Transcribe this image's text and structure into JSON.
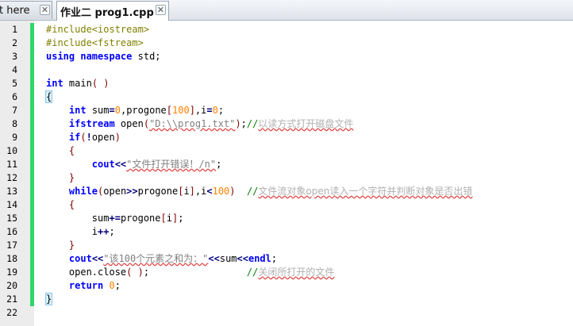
{
  "tabs": [
    {
      "label": "t here",
      "close": "✕",
      "active": false
    },
    {
      "label": "作业二 prog1.cpp",
      "close": "✕",
      "active": true
    }
  ],
  "editor": {
    "lines": [
      {
        "n": "1",
        "tokens": [
          {
            "t": "#include<iostream>",
            "c": "pp"
          }
        ]
      },
      {
        "n": "2",
        "tokens": [
          {
            "t": "#include<fstream>",
            "c": "pp"
          }
        ]
      },
      {
        "n": "3",
        "tokens": [
          {
            "t": "using",
            "c": "kw"
          },
          {
            "t": " "
          },
          {
            "t": "namespace",
            "c": "kw"
          },
          {
            "t": " std;"
          }
        ]
      },
      {
        "n": "4",
        "tokens": []
      },
      {
        "n": "5",
        "tokens": [
          {
            "t": "int",
            "c": "kw"
          },
          {
            "t": " main"
          },
          {
            "t": "( )",
            "c": "br"
          }
        ]
      },
      {
        "n": "6",
        "tokens": [
          {
            "t": "{",
            "c": "brace-hl"
          }
        ]
      },
      {
        "n": "7",
        "tokens": [
          {
            "t": "    "
          },
          {
            "t": "int",
            "c": "kw"
          },
          {
            "t": " sum"
          },
          {
            "t": "=",
            "c": "op"
          },
          {
            "t": "0",
            "c": "num"
          },
          {
            "t": ",progone"
          },
          {
            "t": "[",
            "c": "br"
          },
          {
            "t": "100",
            "c": "num"
          },
          {
            "t": "]",
            "c": "br"
          },
          {
            "t": ",i"
          },
          {
            "t": "=",
            "c": "op"
          },
          {
            "t": "0",
            "c": "num"
          },
          {
            "t": ";"
          }
        ]
      },
      {
        "n": "8",
        "tokens": [
          {
            "t": "    "
          },
          {
            "t": "ifstream",
            "c": "kw"
          },
          {
            "t": " open"
          },
          {
            "t": "(",
            "c": "br"
          },
          {
            "t": "\"D:\\\\prog1.txt\"",
            "c": "str sq"
          },
          {
            "t": ")",
            "c": "br"
          },
          {
            "t": ";"
          },
          {
            "t": "//",
            "c": "cm"
          },
          {
            "t": "以读方式打开磁盘文件",
            "c": "cmt"
          }
        ]
      },
      {
        "n": "9",
        "tokens": [
          {
            "t": "    "
          },
          {
            "t": "if",
            "c": "kw"
          },
          {
            "t": "(",
            "c": "br"
          },
          {
            "t": "!",
            "c": "op"
          },
          {
            "t": "open"
          },
          {
            "t": ")",
            "c": "br"
          }
        ]
      },
      {
        "n": "10",
        "tokens": [
          {
            "t": "    "
          },
          {
            "t": "{",
            "c": "br"
          }
        ]
      },
      {
        "n": "11",
        "tokens": [
          {
            "t": "        "
          },
          {
            "t": "cout",
            "c": "kw"
          },
          {
            "t": "<<",
            "c": "op"
          },
          {
            "t": "\"文件打开错误！/n\"",
            "c": "str sq"
          },
          {
            "t": ";"
          }
        ]
      },
      {
        "n": "12",
        "tokens": [
          {
            "t": "    "
          },
          {
            "t": "}",
            "c": "br"
          }
        ]
      },
      {
        "n": "13",
        "tokens": [
          {
            "t": "    "
          },
          {
            "t": "while",
            "c": "kw"
          },
          {
            "t": "(",
            "c": "br"
          },
          {
            "t": "open"
          },
          {
            "t": ">>",
            "c": "op"
          },
          {
            "t": "progone"
          },
          {
            "t": "[",
            "c": "br"
          },
          {
            "t": "i"
          },
          {
            "t": "]",
            "c": "br"
          },
          {
            "t": ",i"
          },
          {
            "t": "<",
            "c": "op"
          },
          {
            "t": "100",
            "c": "num"
          },
          {
            "t": ")",
            "c": "br"
          },
          {
            "t": "  "
          },
          {
            "t": "//",
            "c": "cm"
          },
          {
            "t": "文件流对象open读入一个字符并判断对象是否出错",
            "c": "cmt"
          }
        ]
      },
      {
        "n": "14",
        "tokens": [
          {
            "t": "    "
          },
          {
            "t": "{",
            "c": "br"
          }
        ]
      },
      {
        "n": "15",
        "tokens": [
          {
            "t": "        sum"
          },
          {
            "t": "+=",
            "c": "op"
          },
          {
            "t": "progone"
          },
          {
            "t": "[",
            "c": "br"
          },
          {
            "t": "i"
          },
          {
            "t": "]",
            "c": "br"
          },
          {
            "t": ";"
          }
        ]
      },
      {
        "n": "16",
        "tokens": [
          {
            "t": "        i"
          },
          {
            "t": "++",
            "c": "op"
          },
          {
            "t": ";"
          }
        ]
      },
      {
        "n": "17",
        "tokens": [
          {
            "t": "    "
          },
          {
            "t": "}",
            "c": "br"
          }
        ]
      },
      {
        "n": "18",
        "tokens": [
          {
            "t": "    "
          },
          {
            "t": "cout",
            "c": "kw"
          },
          {
            "t": "<<",
            "c": "op"
          },
          {
            "t": "\"该100个元素之和为：\"",
            "c": "str sq"
          },
          {
            "t": "<<",
            "c": "op"
          },
          {
            "t": "sum"
          },
          {
            "t": "<<",
            "c": "op"
          },
          {
            "t": "endl",
            "c": "kw"
          },
          {
            "t": ";"
          }
        ]
      },
      {
        "n": "19",
        "tokens": [
          {
            "t": "    open.close"
          },
          {
            "t": "( )",
            "c": "br"
          },
          {
            "t": ";"
          },
          {
            "t": "                 "
          },
          {
            "t": "//",
            "c": "cm"
          },
          {
            "t": "关闭所打开的文件",
            "c": "cmt"
          }
        ]
      },
      {
        "n": "20",
        "tokens": [
          {
            "t": "    "
          },
          {
            "t": "return",
            "c": "kw"
          },
          {
            "t": " "
          },
          {
            "t": "0",
            "c": "num"
          },
          {
            "t": ";"
          }
        ]
      },
      {
        "n": "21",
        "tokens": [
          {
            "t": "}",
            "c": "brace-hl"
          }
        ]
      },
      {
        "n": "22",
        "tokens": []
      }
    ]
  }
}
